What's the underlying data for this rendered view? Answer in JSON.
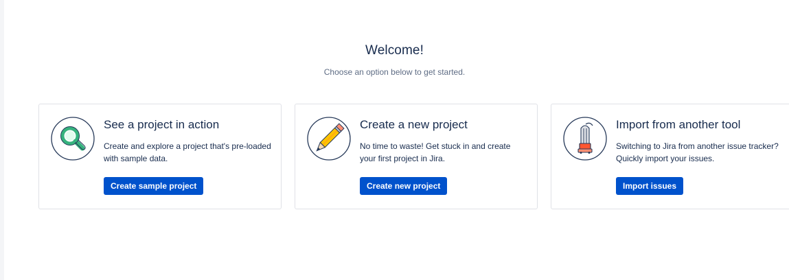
{
  "welcome": {
    "title": "Welcome!",
    "subtitle": "Choose an option below to get started."
  },
  "cards": [
    {
      "icon": "magnifying-glass-icon",
      "title": "See a project in action",
      "description": "Create and explore a project that's pre-loaded with sample data.",
      "button_label": "Create sample project"
    },
    {
      "icon": "pencil-icon",
      "title": "Create a new project",
      "description": "No time to waste! Get stuck in and create your first project in Jira.",
      "button_label": "Create new project"
    },
    {
      "icon": "vacuum-cleaner-icon",
      "title": "Import from another tool",
      "description": "Switching to Jira from another issue tracker? Quickly import your issues.",
      "button_label": "Import issues"
    }
  ],
  "colors": {
    "primary_button": "#0052cc",
    "text": "#172b4d",
    "subtle_text": "#5e6c84",
    "card_border": "#dfe1e6"
  }
}
